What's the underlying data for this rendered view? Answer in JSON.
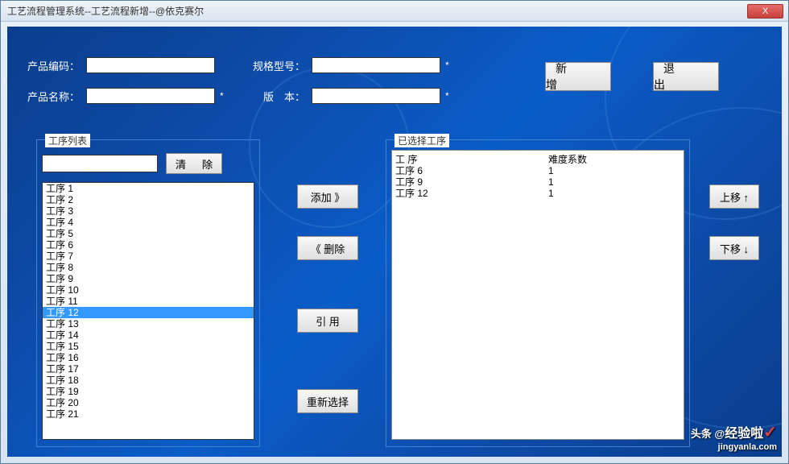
{
  "window": {
    "title": "工艺流程管理系统--工艺流程新增--@依克赛尔",
    "close": "X"
  },
  "form": {
    "product_code_label": "产品编码：",
    "product_code": "",
    "spec_label": "规格型号：",
    "spec": "",
    "product_name_label": "产品名称：",
    "product_name": "",
    "version_label": "版　本：",
    "version": "",
    "star": "*"
  },
  "buttons": {
    "add_new": "新　增",
    "exit": "退　出",
    "add": "添加 》",
    "remove": "《 删除",
    "reference": "引 用",
    "reselect": "重新选择",
    "clear": "清 除",
    "move_up": "上移 ↑",
    "move_down": "下移 ↓"
  },
  "process_list": {
    "title": "工序列表",
    "filter": "",
    "items": [
      "工序 1",
      "工序 2",
      "工序 3",
      "工序 4",
      "工序 5",
      "工序 6",
      "工序 7",
      "工序 8",
      "工序 9",
      "工序 10",
      "工序 11",
      "工序 12",
      "工序 13",
      "工序 14",
      "工序 15",
      "工序 16",
      "工序 17",
      "工序 18",
      "工序 19",
      "工序 20",
      "工序 21"
    ],
    "selected_index": 11
  },
  "selected_list": {
    "title": "已选择工序",
    "header_col1": "工 序",
    "header_col2": "难度系数",
    "rows": [
      {
        "name": "工序 6",
        "factor": "1"
      },
      {
        "name": "工序 9",
        "factor": "1"
      },
      {
        "name": "工序 12",
        "factor": "1"
      }
    ]
  },
  "watermark": {
    "prefix": "头条 @",
    "main": "经验啦",
    "sub": "jingyanla.com"
  }
}
